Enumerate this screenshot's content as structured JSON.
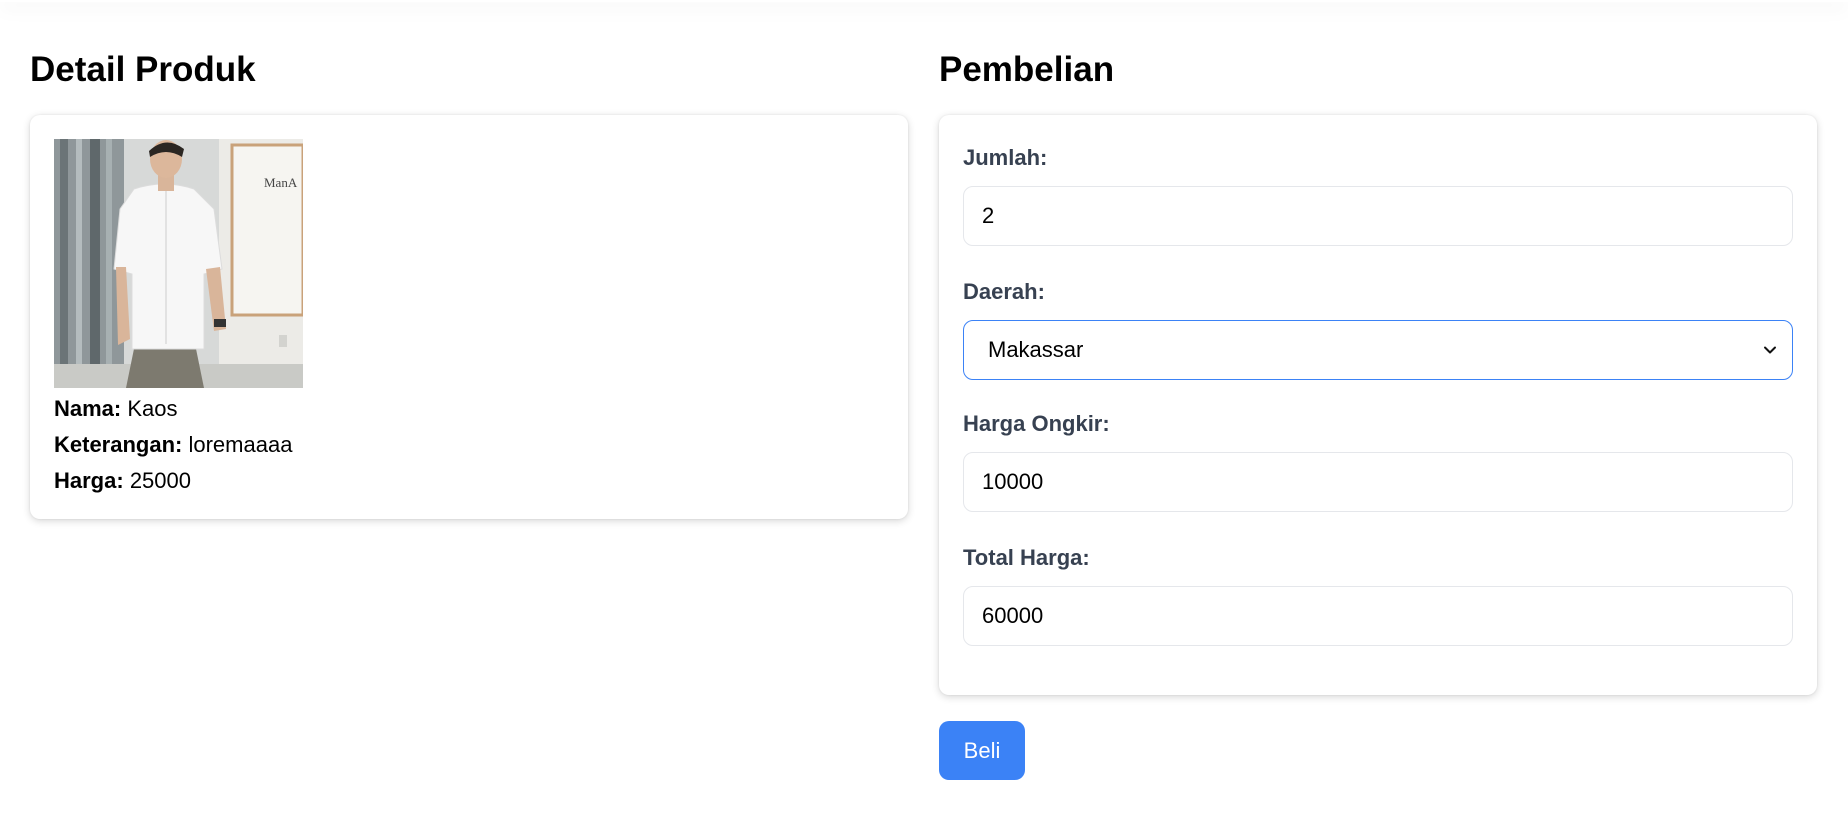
{
  "detail": {
    "heading": "Detail Produk",
    "product": {
      "name_label": "Nama:",
      "name": "Kaos",
      "description_label": "Keterangan:",
      "description": "loremaaaa",
      "price_label": "Harga:",
      "price": "25000",
      "image_sign_text": "ManA"
    }
  },
  "purchase": {
    "heading": "Pembelian",
    "quantity_label": "Jumlah:",
    "quantity_value": "2",
    "region_label": "Daerah:",
    "region_value": "Makassar",
    "shipping_label": "Harga Ongkir:",
    "shipping_value": "10000",
    "total_label": "Total Harga:",
    "total_value": "60000",
    "buy_label": "Beli"
  },
  "icons": {
    "select_arrow": "chevron-down-icon"
  },
  "colors": {
    "accent": "#3b82f6",
    "label_text": "#374151",
    "input_border": "#e5e7eb"
  }
}
